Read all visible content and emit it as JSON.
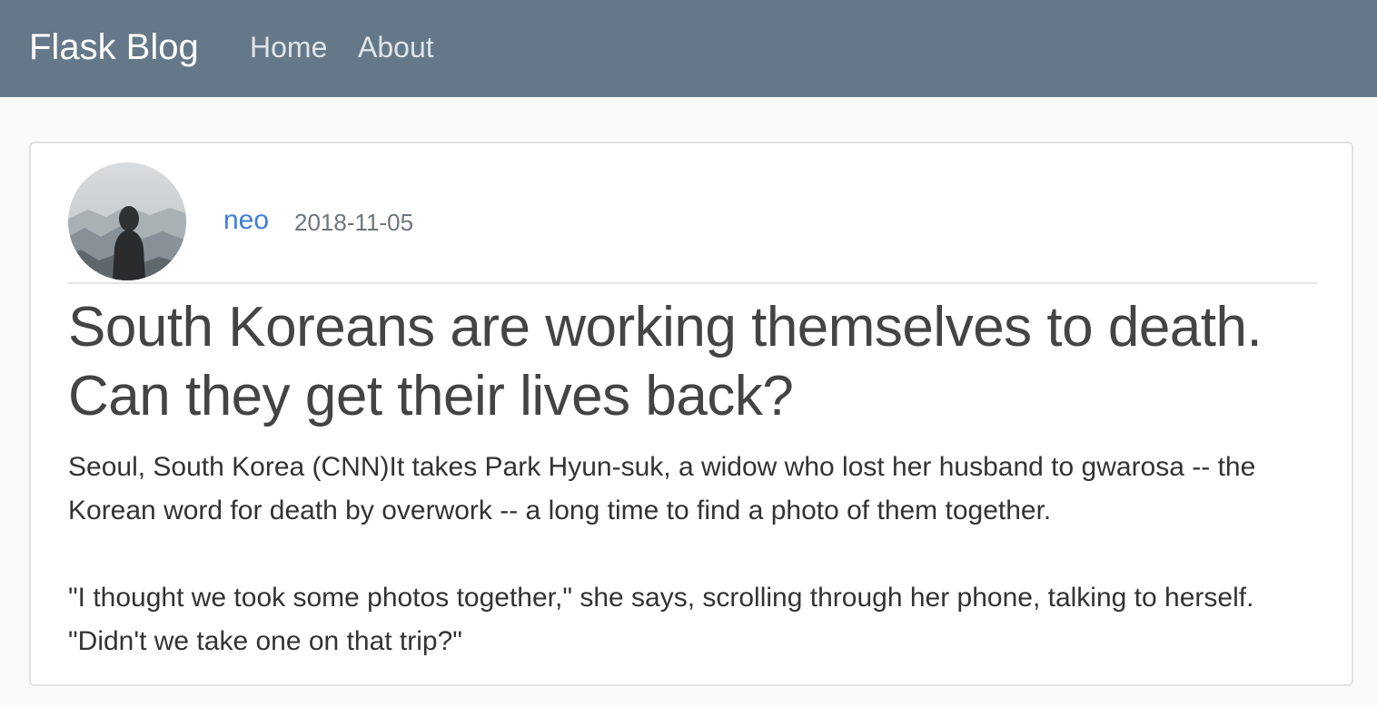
{
  "navbar": {
    "brand": "Flask Blog",
    "links": [
      "Home",
      "About"
    ]
  },
  "post": {
    "author": "neo",
    "date": "2018-11-05",
    "title": "South Koreans are working themselves to death. Can they get their lives back?",
    "paragraphs": [
      "Seoul, South Korea (CNN)It takes Park Hyun-suk, a widow who lost her husband to gwarosa -- the Korean word for death by overwork -- a long time to find a photo of them together.",
      "\"I thought we took some photos together,\" she says, scrolling through her phone, talking to herself. \"Didn't we take one on that trip?\""
    ]
  },
  "colors": {
    "navbar": "#657889",
    "link": "#3d7ed9",
    "muted": "#6c757d",
    "title": "#444444"
  }
}
